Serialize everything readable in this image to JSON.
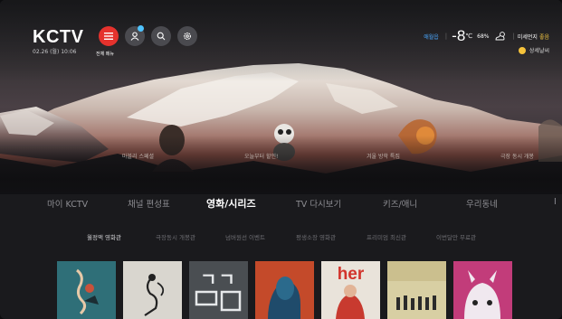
{
  "header": {
    "logo": "KCTV",
    "date": "02.26 (월) 10:06",
    "menu_label": "전체 메뉴",
    "icons": [
      "menu-icon",
      "user-icon",
      "search-icon",
      "gear-icon"
    ]
  },
  "weather": {
    "location": "애월읍",
    "temperature": "-8",
    "unit": "℃",
    "humidity": "68%",
    "condition_icon": "partly-cloudy-icon",
    "dust_label": "미세먼지",
    "dust_value": "좋음",
    "detail_label": "상세날씨"
  },
  "hero": {
    "promos": [
      "마블리 스페셜",
      "오늘부터 할인!",
      "겨울 방학 특집",
      "극장 동시 개봉"
    ]
  },
  "tabs": [
    {
      "label": "마이 KCTV",
      "active": false
    },
    {
      "label": "채널 편성표",
      "active": false
    },
    {
      "label": "영화/시리즈",
      "active": true
    },
    {
      "label": "TV 다시보기",
      "active": false
    },
    {
      "label": "키즈/애니",
      "active": false
    },
    {
      "label": "우리동네",
      "active": false
    },
    {
      "label": "I",
      "active": false
    }
  ],
  "subtabs": [
    {
      "label": "월정액 영화관",
      "active": true
    },
    {
      "label": "극장동시 개봉관",
      "active": false
    },
    {
      "label": "넘버원선 이벤트",
      "active": false
    },
    {
      "label": "평생소장 영화관",
      "active": false
    },
    {
      "label": "프리미엄 최신관",
      "active": false
    },
    {
      "label": "이번달만 무료관",
      "active": false
    }
  ],
  "posters": [
    {
      "title": "",
      "bg": "#2f6f78"
    },
    {
      "title": "",
      "bg": "#d9d6cf"
    },
    {
      "title": "ㄱㄱ",
      "bg": "#4a4e52"
    },
    {
      "title": "",
      "bg": "#c44a2a"
    },
    {
      "title": "her",
      "bg": "#e9e3da"
    },
    {
      "title": "",
      "bg": "#d8cfa3"
    },
    {
      "title": "",
      "bg": "#c23c7a"
    }
  ],
  "colors": {
    "accent_red": "#e5322d",
    "accent_blue": "#4aa8ff",
    "dust_good": "#f5c842"
  }
}
